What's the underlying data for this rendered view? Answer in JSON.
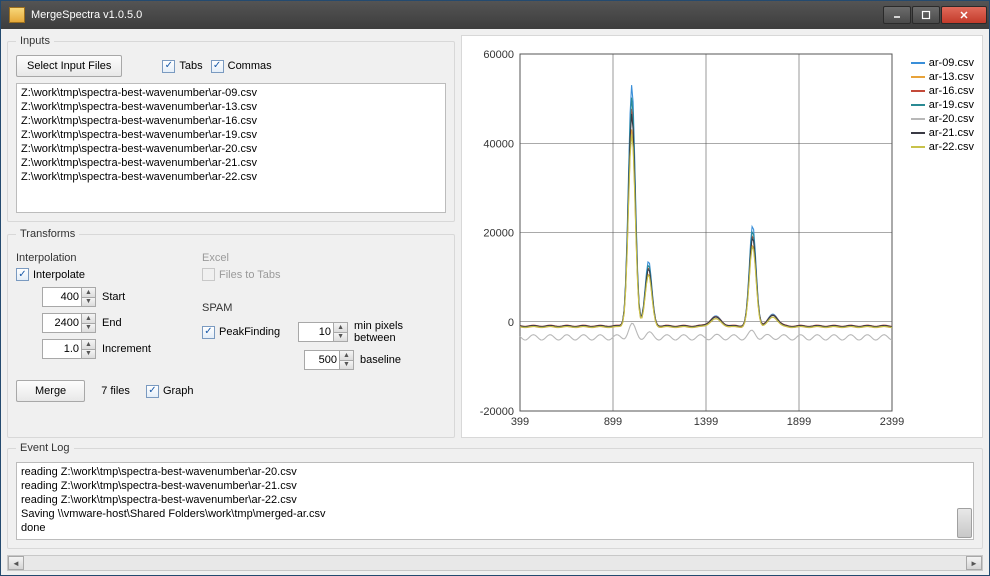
{
  "window": {
    "title": "MergeSpectra v1.0.5.0"
  },
  "inputs": {
    "legend": "Inputs",
    "select_btn": "Select Input Files",
    "tabs_label": "Tabs",
    "tabs_checked": true,
    "commas_label": "Commas",
    "commas_checked": true,
    "files": [
      "Z:\\work\\tmp\\spectra-best-wavenumber\\ar-09.csv",
      "Z:\\work\\tmp\\spectra-best-wavenumber\\ar-13.csv",
      "Z:\\work\\tmp\\spectra-best-wavenumber\\ar-16.csv",
      "Z:\\work\\tmp\\spectra-best-wavenumber\\ar-19.csv",
      "Z:\\work\\tmp\\spectra-best-wavenumber\\ar-20.csv",
      "Z:\\work\\tmp\\spectra-best-wavenumber\\ar-21.csv",
      "Z:\\work\\tmp\\spectra-best-wavenumber\\ar-22.csv"
    ]
  },
  "transforms": {
    "legend": "Transforms",
    "interpolation": {
      "title": "Interpolation",
      "interpolate_label": "Interpolate",
      "interpolate_checked": true,
      "start_label": "Start",
      "start_value": "400",
      "end_label": "End",
      "end_value": "2400",
      "incr_label": "Increment",
      "incr_value": "1.0"
    },
    "excel": {
      "title": "Excel",
      "files_to_tabs_label": "Files to Tabs",
      "files_to_tabs_checked": false,
      "enabled": false
    },
    "spam": {
      "title": "SPAM",
      "peakfinding_label": "PeakFinding",
      "peakfinding_checked": true,
      "minpix_value": "10",
      "minpix_label": "min pixels between",
      "baseline_value": "500",
      "baseline_label": "baseline"
    },
    "merge_btn": "Merge",
    "file_count": "7 files",
    "graph_label": "Graph",
    "graph_checked": true
  },
  "eventlog": {
    "legend": "Event Log",
    "lines": [
      "reading Z:\\work\\tmp\\spectra-best-wavenumber\\ar-20.csv",
      "reading Z:\\work\\tmp\\spectra-best-wavenumber\\ar-21.csv",
      "reading Z:\\work\\tmp\\spectra-best-wavenumber\\ar-22.csv",
      "Saving \\\\vmware-host\\Shared Folders\\work\\tmp\\merged-ar.csv",
      "done"
    ]
  },
  "chart_data": {
    "type": "line",
    "xlim": [
      399,
      2399
    ],
    "ylim": [
      -20000,
      60000
    ],
    "xticks": [
      399,
      899,
      1399,
      1899,
      2399
    ],
    "yticks": [
      -20000,
      0,
      20000,
      40000,
      60000
    ],
    "legend_position": "right",
    "series": [
      {
        "name": "ar-09.csv",
        "color": "#3a8fd9"
      },
      {
        "name": "ar-13.csv",
        "color": "#e8a33a"
      },
      {
        "name": "ar-16.csv",
        "color": "#c44a3a"
      },
      {
        "name": "ar-19.csv",
        "color": "#2a8a94"
      },
      {
        "name": "ar-20.csv",
        "color": "#b8b8b8"
      },
      {
        "name": "ar-21.csv",
        "color": "#3a3a44"
      },
      {
        "name": "ar-22.csv",
        "color": "#c8c24a"
      }
    ],
    "approx_peaks": [
      {
        "x": 1000,
        "y": 54000
      },
      {
        "x": 1090,
        "y": 14500
      },
      {
        "x": 1650,
        "y": 22500
      }
    ],
    "baseline_y": -1000
  }
}
